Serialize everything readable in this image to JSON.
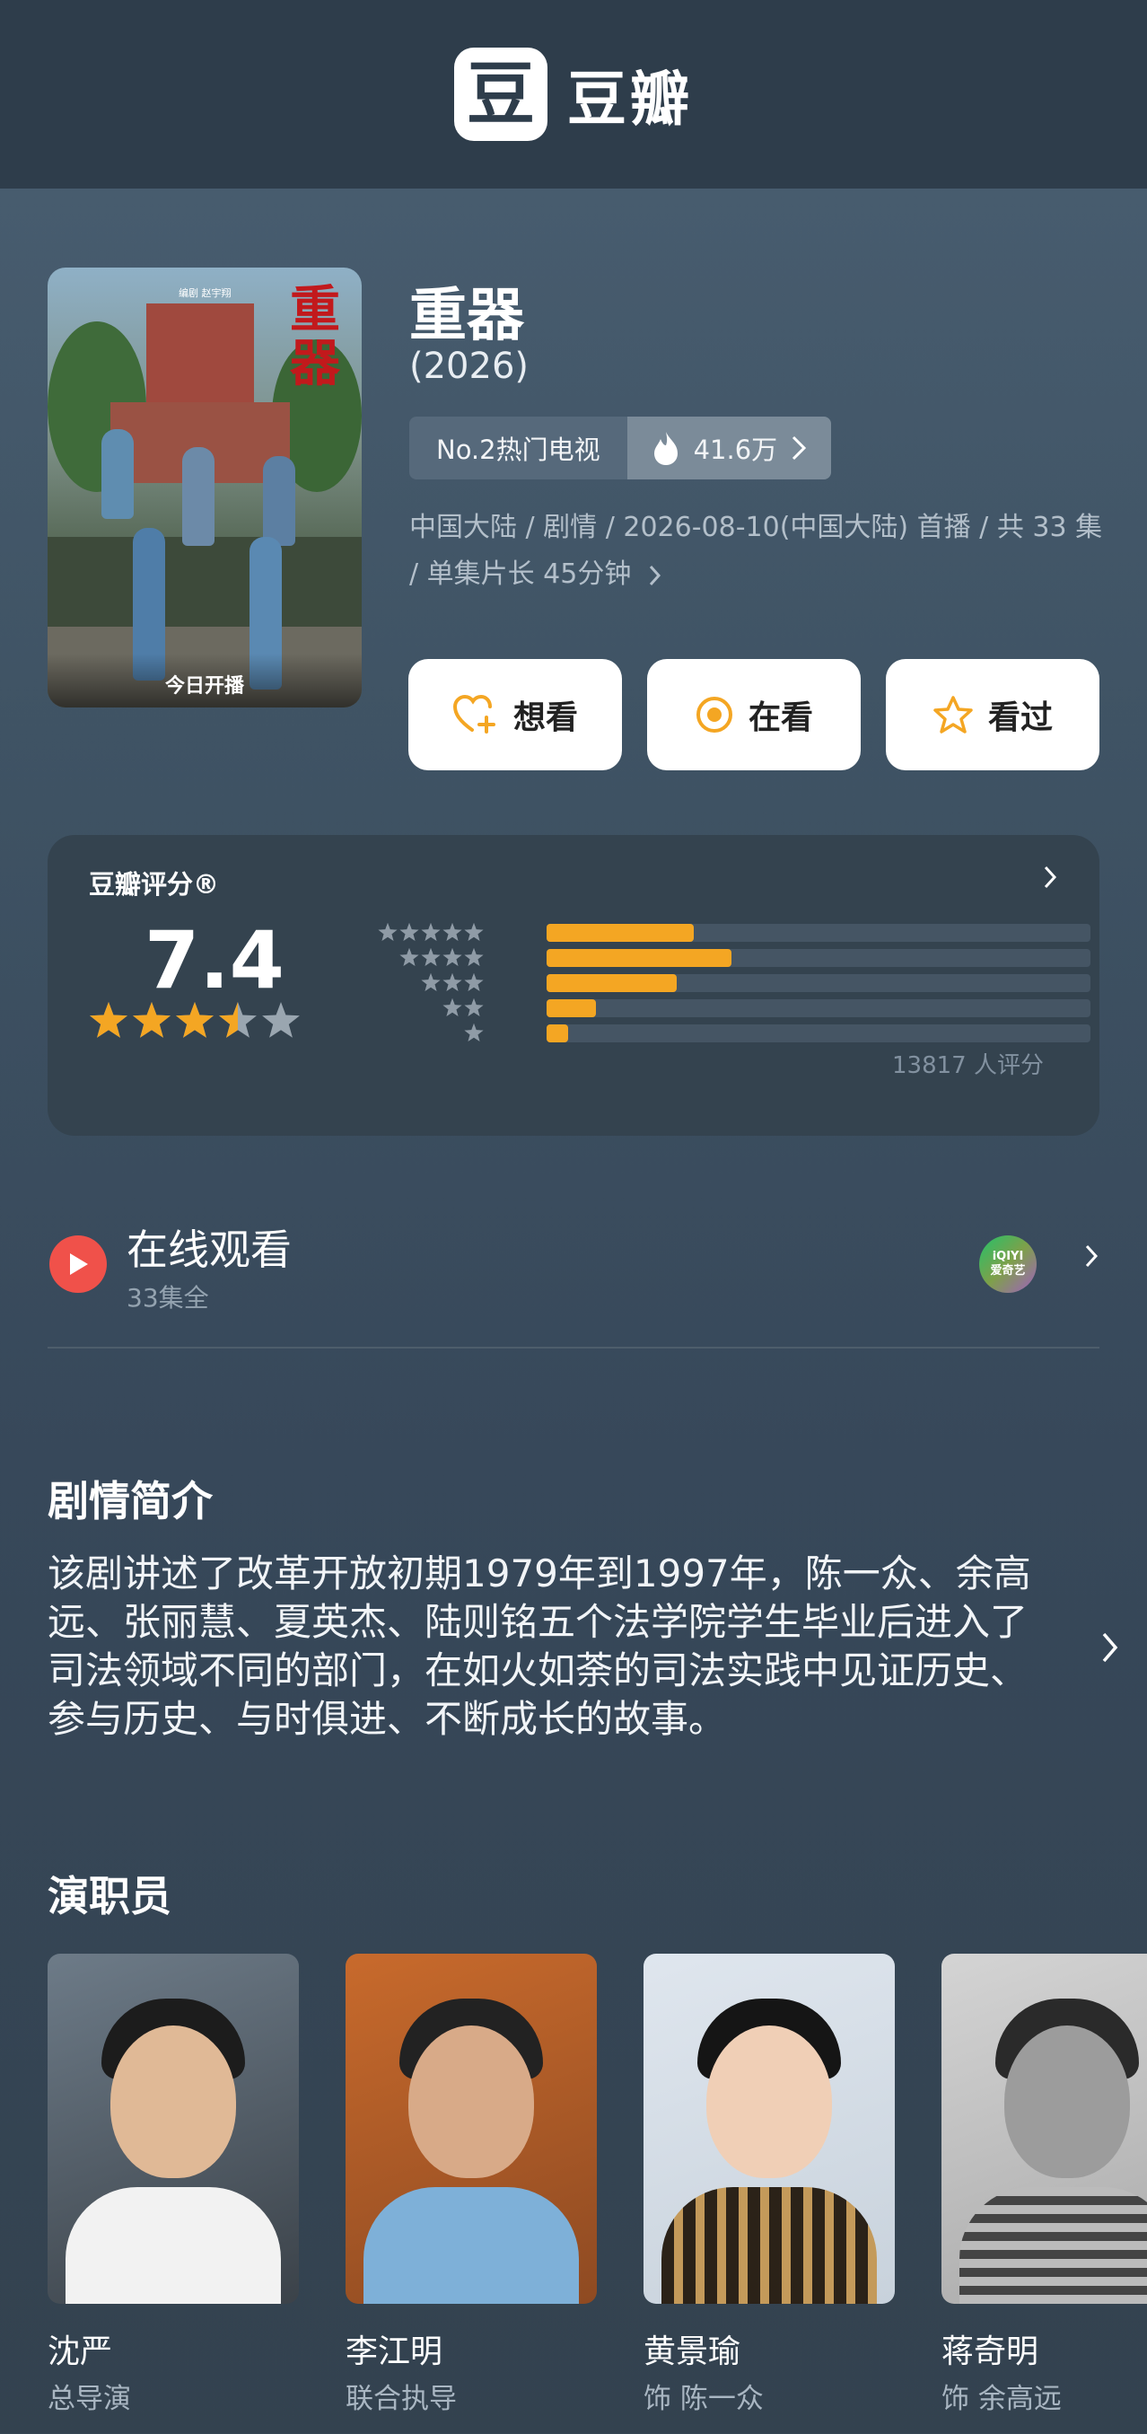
{
  "app": {
    "logo_char": "豆",
    "logo_text": "豆瓣"
  },
  "poster": {
    "title": "重器",
    "credit": "编剧 赵宇翔",
    "badge": "今日开播"
  },
  "show": {
    "title": "重器",
    "year": "(2026)",
    "rank_label": "No.2热门电视",
    "heat": "41.6万",
    "meta": "中国大陆 / 剧情 / 2026-08-10(中国大陆) 首播 / 共 33 集 / 单集片长 45分钟"
  },
  "actions": [
    {
      "label": "想看",
      "icon": "heart-plus-icon"
    },
    {
      "label": "在看",
      "icon": "watching-circle-icon"
    },
    {
      "label": "看过",
      "icon": "star-outline-icon"
    }
  ],
  "rating": {
    "label": "豆瓣评分®",
    "score": "7.4",
    "stars_value": 3.5,
    "distribution": [
      {
        "stars": 5,
        "fraction": 0.27
      },
      {
        "stars": 4,
        "fraction": 0.34
      },
      {
        "stars": 3,
        "fraction": 0.24
      },
      {
        "stars": 2,
        "fraction": 0.09
      },
      {
        "stars": 1,
        "fraction": 0.04
      }
    ],
    "count": "13817 人评分"
  },
  "online": {
    "title": "在线观看",
    "subtitle": "33集全",
    "provider": "iQIYI",
    "provider_cn": "爱奇艺"
  },
  "synopsis": {
    "heading": "剧情简介",
    "text": "该剧讲述了改革开放初期1979年到1997年，陈一众、余高远、张丽慧、夏英杰、陆则铭五个法学院学生毕业后进入了司法领域不同的部门，在如火如荼的司法实践中见证历史、参与历史、与时俱进、不断成长的故事。"
  },
  "cast": {
    "heading": "演职员",
    "people": [
      {
        "name": "沈严",
        "role": "总导演"
      },
      {
        "name": "李江明",
        "role": "联合执导"
      },
      {
        "name": "黄景瑜",
        "role": "饰 陈一众"
      },
      {
        "name": "蒋奇明",
        "role": "饰 余高远"
      }
    ]
  },
  "colors": {
    "accent": "#f4a623",
    "play": "#f0514a",
    "topbar": "#2e3d4b"
  }
}
